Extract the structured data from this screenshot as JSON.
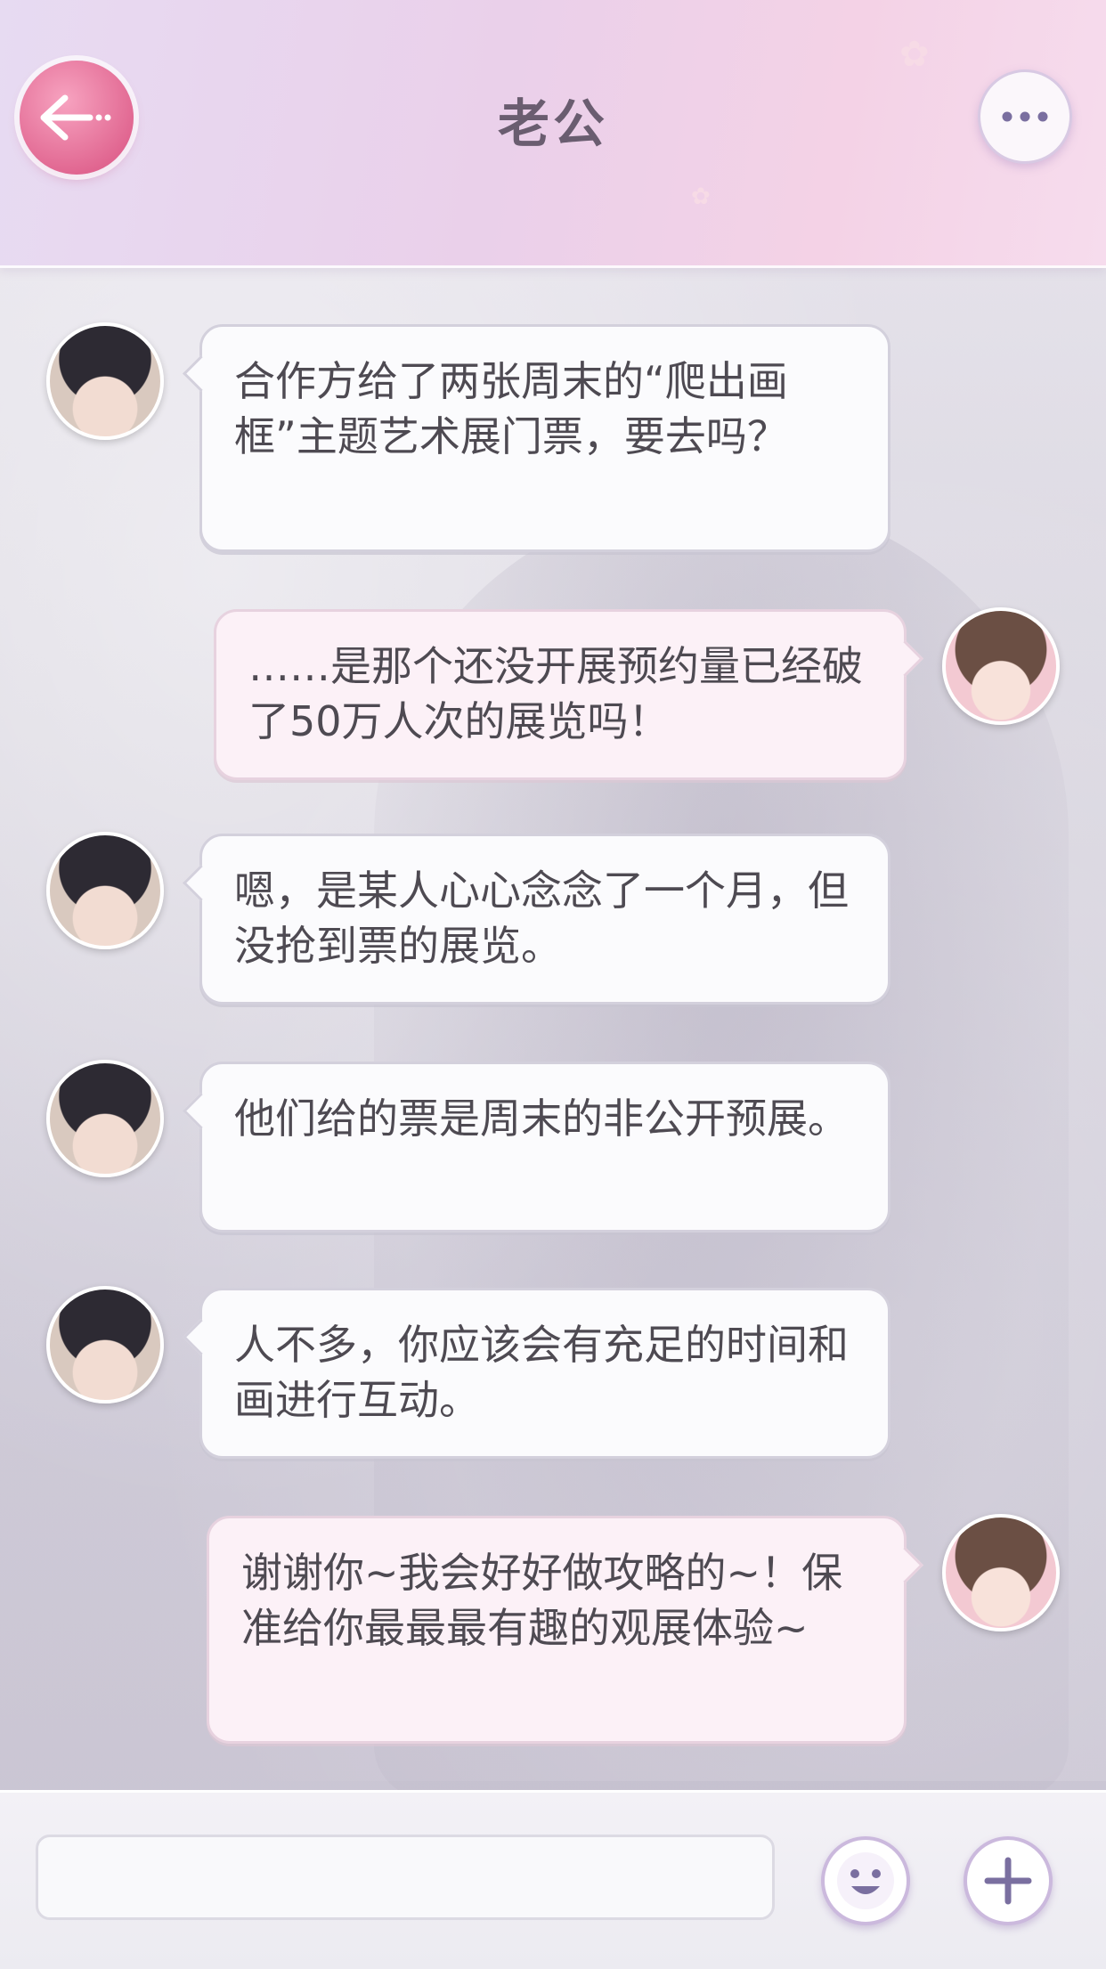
{
  "header": {
    "title": "老公"
  },
  "colors": {
    "accent_pink": "#e0648f",
    "bubble_in": "#fbfbfd",
    "bubble_out": "#fcf1f7",
    "text": "#4e4a52"
  },
  "icons": {
    "back": "arrow-left-icon",
    "more": "ellipsis-icon",
    "emoji": "smiley-icon",
    "plus": "plus-icon"
  },
  "messages": [
    {
      "sender": "contact",
      "text": "合作方给了两张周末的“爬出画框”主题艺术展门票，要去吗？"
    },
    {
      "sender": "me",
      "text": "……是那个还没开展预约量已经破了50万人次的展览吗！"
    },
    {
      "sender": "contact",
      "text": "嗯，是某人心心念念了一个月，但没抢到票的展览。"
    },
    {
      "sender": "contact",
      "text": "他们给的票是周末的非公开预展。"
    },
    {
      "sender": "contact",
      "text": "人不多，你应该会有充足的时间和画进行互动。"
    },
    {
      "sender": "me",
      "text": "谢谢你~我会好好做攻略的~！保准给你最最最有趣的观展体验~"
    }
  ],
  "input": {
    "value": "",
    "placeholder": ""
  }
}
